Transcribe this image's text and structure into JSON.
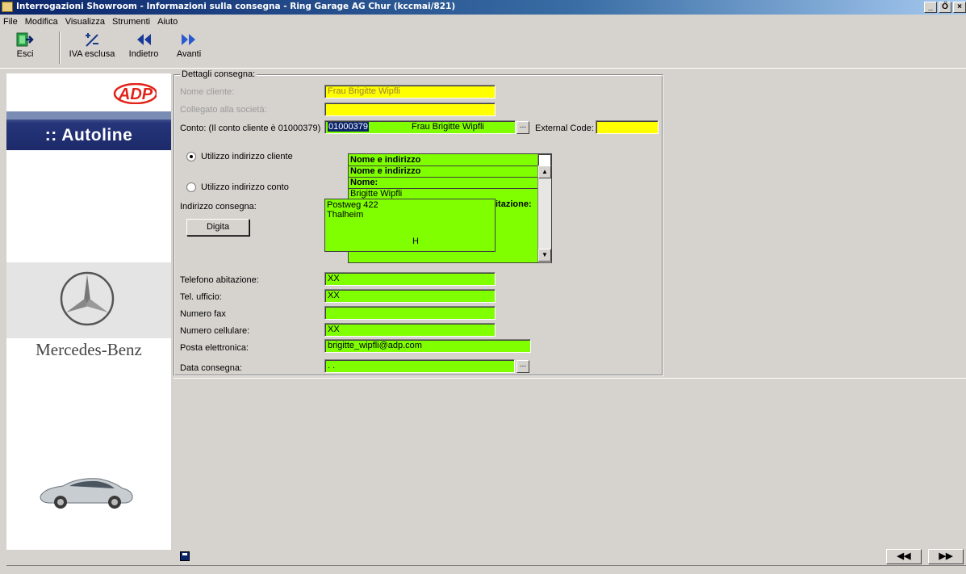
{
  "window": {
    "title": "Interrogazioni Showroom - Informazioni sulla consegna - Ring Garage AG Chur (kccmai/821)",
    "controls": [
      "_",
      "Ő",
      "×"
    ]
  },
  "menu": [
    {
      "label": "File"
    },
    {
      "label": "Modifica"
    },
    {
      "label": "Visualizza"
    },
    {
      "label": "Strumenti"
    },
    {
      "label": "Aiuto"
    }
  ],
  "toolbar": {
    "exit_label": "Esci",
    "vat_label": "IVA esclusa",
    "back_label": "Indietro",
    "forward_label": "Avanti"
  },
  "brand": {
    "adp": "ADP",
    "autoline": ":: Autoline",
    "mercedes": "Mercedes-Benz"
  },
  "form": {
    "group_title": "Dettagli consegna:",
    "customer_name_label": "Nome cliente:",
    "customer_name_value": "Frau Brigitte Wipfli",
    "company_label": "Collegato alla società:",
    "company_value": "",
    "account_label": "Conto: (Il conto cliente è 01000379)",
    "account_code": "01000379",
    "account_name": "Frau Brigitte Wipfli",
    "ellipsis": "...",
    "external_code_label": "External Code:",
    "external_code_value": "",
    "radio_customer_label": "Utilizzo indirizzo cliente",
    "radio_account_label": "Utilizzo indirizzo conto",
    "delivery_address_label": "Indirizzo consegna:",
    "digita_label": "Digita",
    "address_list": {
      "line1": "Nome e indirizzo",
      "line2": "Nome e indirizzo",
      "line3": "Nome:",
      "line4": "Brigitte  Wipfli",
      "hidden_fragment": "itazione:"
    },
    "address_text": {
      "street": "Postweg 422",
      "city": "Thalheim",
      "country": "H"
    },
    "phone_home_label": "Telefono abitazione:",
    "phone_home_value": "XX",
    "phone_office_label": "Tel. ufficio:",
    "phone_office_value": "XX",
    "fax_label": "Numero fax",
    "fax_value": "",
    "mobile_label": "Numero cellulare:",
    "mobile_value": "XX",
    "email_label": "Posta elettronica:",
    "email_value": "brigitte_wipfli@adp.com",
    "delivery_date_label": "Data consegna:",
    "delivery_date_value": " .  ."
  },
  "footer": {
    "prev_label": "◀◀",
    "next_label": "▶▶"
  },
  "colors": {
    "title_start": "#0a246a",
    "yellow_field": "#ffff00",
    "green_field": "#80ff00",
    "adp_red": "#e2231a",
    "autoline_blue": "#1c2a6a"
  }
}
